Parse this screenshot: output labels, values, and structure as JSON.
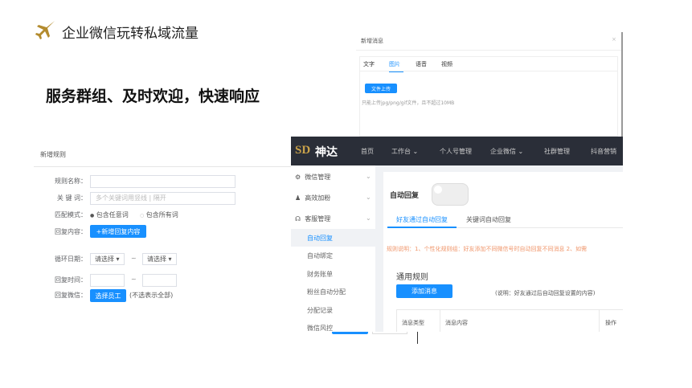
{
  "slide": {
    "title": "企业微信玩转私域流量",
    "heading": "服务群组、及时欢迎，快速响应"
  },
  "msg_dialog": {
    "title": "新增消息",
    "close": "×",
    "tabs": [
      "文字",
      "图片",
      "语音",
      "视频"
    ],
    "active_tab": 1,
    "upload_button": "文件上传",
    "hint": "只能上传jpg/png/gif文件，且不超过10MB"
  },
  "rule_form": {
    "title": "新增规则",
    "name_label": "规则名称：",
    "keyword_label": "关 键 词：",
    "keyword_placeholder": "多个关键词用竖线 | 隔开",
    "match_label": "匹配模式：",
    "match_any": "包含任意词",
    "match_all": "包含所有词",
    "reply_label": "回复内容：",
    "add_reply_button": "+新增回复内容",
    "date_label": "循环日期：",
    "select_placeholder": "请选择",
    "tilde": "~",
    "time_label": "回复时间：",
    "wechat_label": "回复微信：",
    "select_staff_button": "选择员工",
    "select_staff_hint": "(不选表示全部)"
  },
  "app": {
    "logo": "SD",
    "brand": "神达",
    "nav": [
      "首页",
      "工作台",
      "个人号管理",
      "企业微信",
      "社群管理",
      "抖音营销"
    ],
    "sidebar": {
      "groups": [
        "微信管理",
        "高效加粉",
        "客服管理"
      ],
      "items": [
        "自动回复",
        "自动绑定",
        "财务账单",
        "粉丝自动分配",
        "分配记录",
        "微信风控"
      ],
      "active": 0
    },
    "page_title": "自动回复",
    "auto_reply_enabled": false,
    "tabs": [
      "好友通过自动回复",
      "关键词自动回复"
    ],
    "active_tab": 0,
    "rule_note": "规则说明：1、个性化规则组：好友添加不同微信号时自动回复不同消息 2、如需",
    "section_title": "通用规则",
    "add_button": "添加消息",
    "add_note": "(说明：好友通过后自动回复设置的内容)",
    "table_headers": [
      "消息类型",
      "消息内容",
      "操作"
    ]
  },
  "colors": {
    "accent": "#1890ff",
    "nav_bg": "#2a2e38",
    "warn": "#f0966b",
    "logo_gold": "#b38b2e"
  }
}
